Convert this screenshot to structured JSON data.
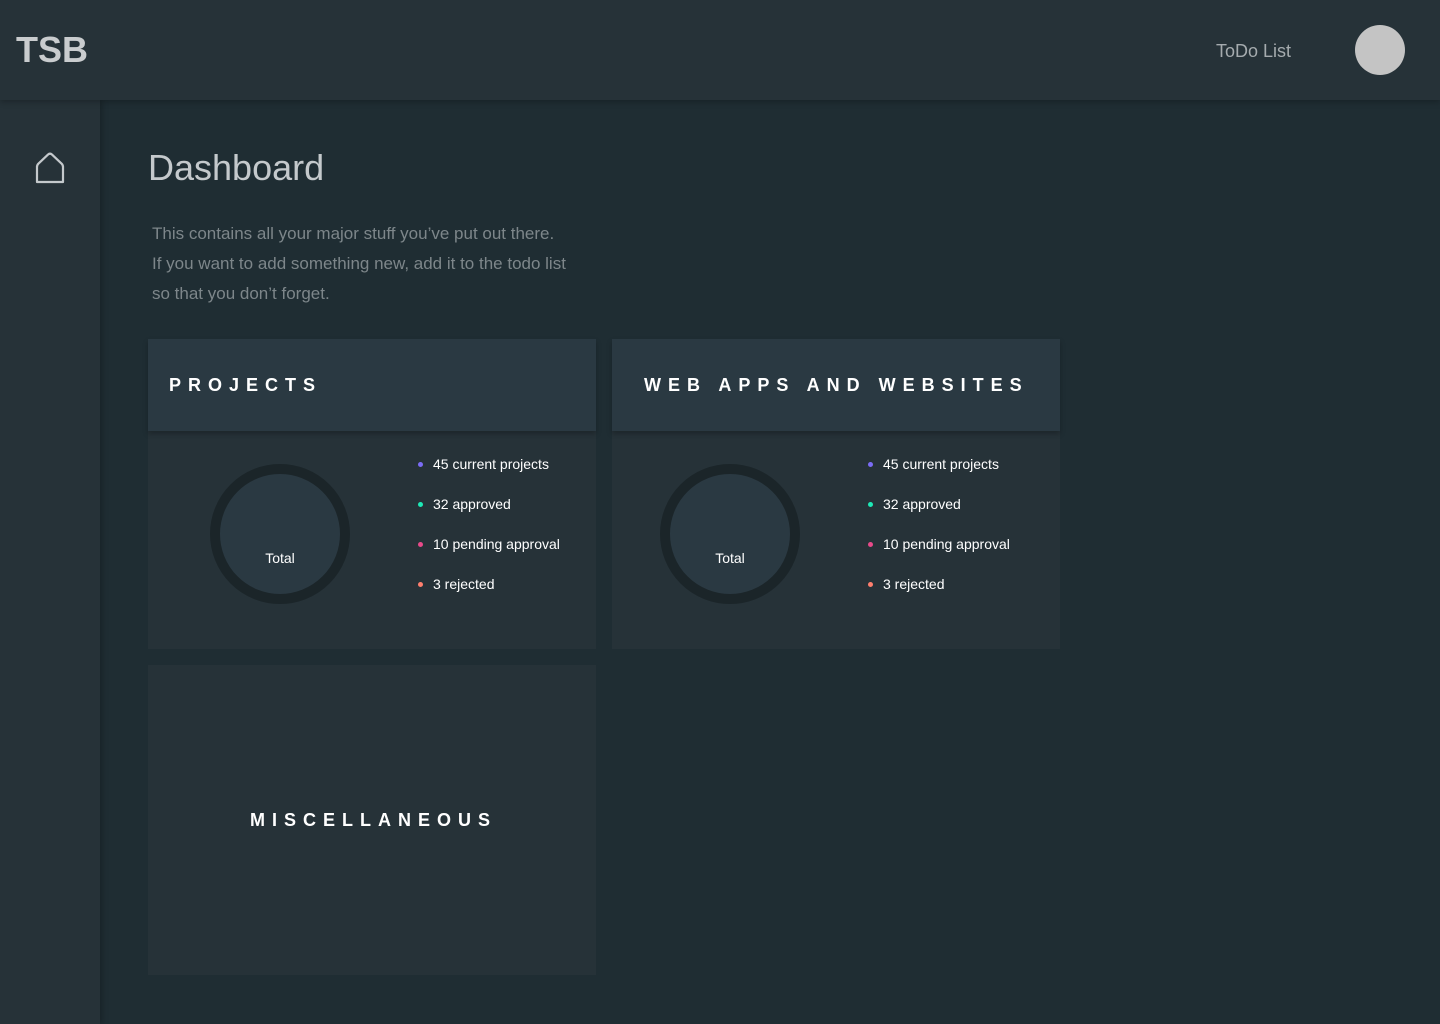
{
  "header": {
    "logo": "TSB",
    "nav_todo": "ToDo List"
  },
  "sidebar": {
    "home_icon": "home-icon"
  },
  "main": {
    "title": "Dashboard",
    "description_lines": [
      "This contains all your major stuff you’ve put out there.",
      "If you want to add something new, add it to the todo list",
      "so that you don’t forget."
    ]
  },
  "cards": [
    {
      "title": "PROJECTS",
      "donut_label": "Total",
      "legend": [
        {
          "label": "45 current projects",
          "color": "#7b6cf6"
        },
        {
          "label": "32 approved",
          "color": "#1de9b6"
        },
        {
          "label": "10 pending approval",
          "color": "#e84a8a"
        },
        {
          "label": "3 rejected",
          "color": "#ff7f6e"
        }
      ]
    },
    {
      "title": "WEB APPS AND WEBSITES",
      "donut_label": "Total",
      "legend": [
        {
          "label": "45 current projects",
          "color": "#7b6cf6"
        },
        {
          "label": "32 approved",
          "color": "#1de9b6"
        },
        {
          "label": "10 pending approval",
          "color": "#e84a8a"
        },
        {
          "label": "3 rejected",
          "color": "#ff7f6e"
        }
      ]
    },
    {
      "title": "MISCELLANEOUS"
    }
  ],
  "colors": {
    "background": "#1f2d33",
    "surface": "#263238",
    "card_header": "#2a3942"
  }
}
